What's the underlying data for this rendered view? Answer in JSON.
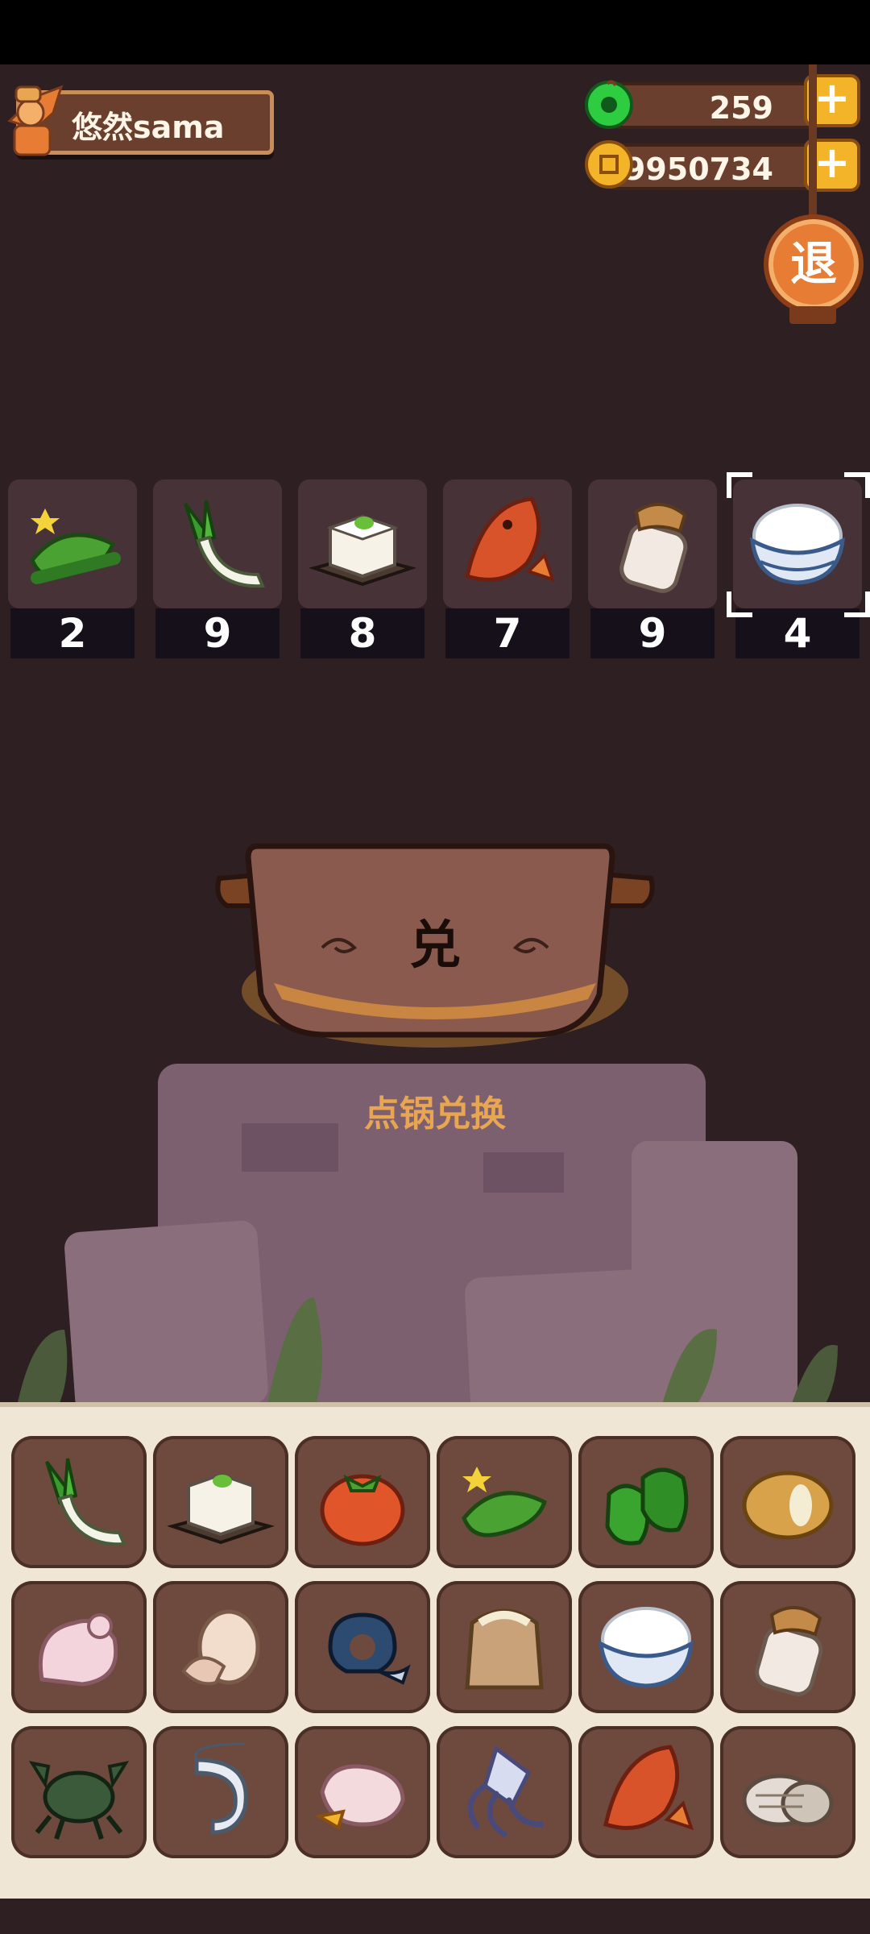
{
  "player": {
    "name": "悠然sama",
    "avatar_icon": "chef-avatar-icon"
  },
  "currency": {
    "jade": {
      "value": "259",
      "icon": "jade-gem-icon",
      "color": "#2ecc40"
    },
    "coins": {
      "value": "39950734",
      "icon": "gold-coin-icon",
      "color": "#f4b429"
    },
    "plus_label": "+"
  },
  "exit": {
    "label": "退"
  },
  "required": [
    {
      "name": "cucumber",
      "count": "2"
    },
    {
      "name": "leek",
      "count": "9"
    },
    {
      "name": "tofu",
      "count": "8"
    },
    {
      "name": "red-fish",
      "count": "7"
    },
    {
      "name": "sauce-jar",
      "count": "9"
    },
    {
      "name": "rice-bowl",
      "count": "4",
      "selected": true
    }
  ],
  "pot": {
    "label": "兑",
    "hint": "点锅兑换"
  },
  "inventory": [
    "leek",
    "tofu",
    "tomato",
    "cucumber",
    "green-pepper",
    "potato",
    "chicken",
    "egg",
    "blue-fish",
    "flour-sack",
    "rice-bowl",
    "sauce-jar",
    "crab",
    "shrimp",
    "duck",
    "squid",
    "red-fish",
    "clam"
  ]
}
